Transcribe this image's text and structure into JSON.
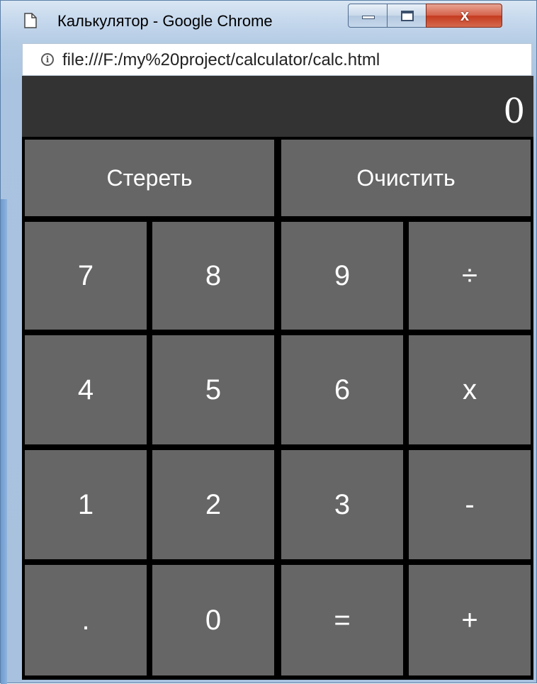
{
  "window": {
    "title": "Калькулятор - Google Chrome",
    "close_glyph": "x"
  },
  "address_bar": {
    "url": "file:///F:/my%20project/calculator/calc.html",
    "info_glyph": "i"
  },
  "calculator": {
    "display": "0",
    "actions": {
      "backspace": "Стереть",
      "clear": "Очистить"
    },
    "keys": [
      [
        "7",
        "8",
        "9",
        "÷"
      ],
      [
        "4",
        "5",
        "6",
        "x"
      ],
      [
        "1",
        "2",
        "3",
        "-"
      ],
      [
        ".",
        "0",
        "=",
        "+"
      ]
    ]
  },
  "colors": {
    "display_bg": "#333333",
    "key_bg": "#666666",
    "key_text": "#ffffff",
    "grid_gap": "#000000"
  }
}
